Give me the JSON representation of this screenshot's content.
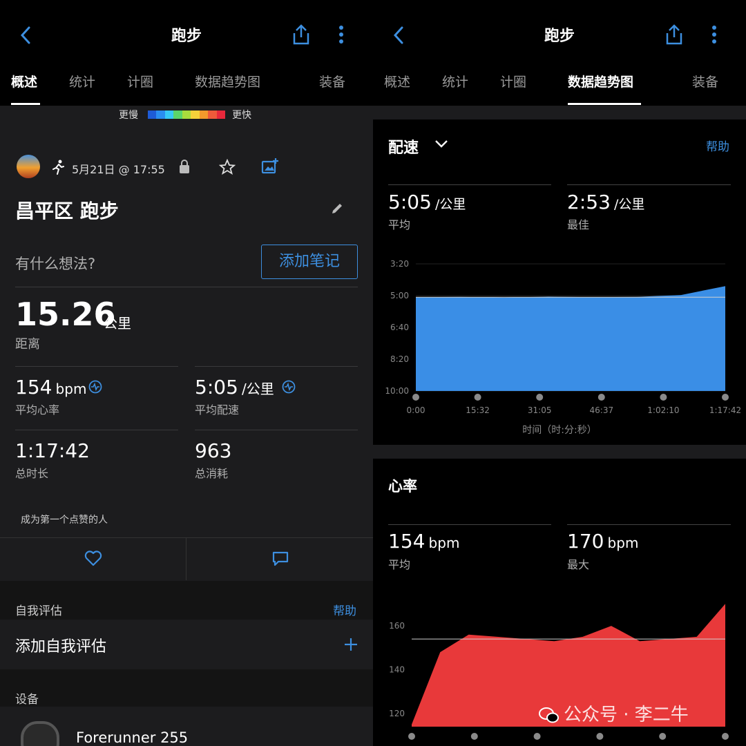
{
  "left": {
    "nav": {
      "title": "跑步"
    },
    "tabs": [
      "概述",
      "统计",
      "计圈",
      "数据趋势图",
      "装备"
    ],
    "pace_legend": {
      "slow": "更慢",
      "fast": "更快",
      "colors": [
        "#1e5bd6",
        "#2a8df0",
        "#36c8f5",
        "#5bd46a",
        "#a9db3d",
        "#f5d23a",
        "#f39a2c",
        "#ef5a3a",
        "#e8283b"
      ]
    },
    "activity": {
      "date": "5月21日 @ 17:55",
      "title": "昌平区 跑步"
    },
    "note": {
      "prompt": "有什么想法?",
      "button": "添加笔记"
    },
    "distance": {
      "value": "15.26",
      "unit": "公里",
      "label": "距离"
    },
    "stats": [
      {
        "value": "154",
        "unit": "bpm",
        "label": "平均心率"
      },
      {
        "value": "5:05",
        "unit": "/公里",
        "label": "平均配速"
      },
      {
        "value": "1:17:42",
        "unit": "",
        "label": "总时长"
      },
      {
        "value": "963",
        "unit": "",
        "label": "总消耗"
      }
    ],
    "likes": "成为第一个点赞的人",
    "self_eval": {
      "header": "自我评估",
      "help": "帮助",
      "add": "添加自我评估"
    },
    "device": {
      "header": "设备",
      "name": "Forerunner 255"
    }
  },
  "right": {
    "nav": {
      "title": "跑步"
    },
    "tabs": [
      "概述",
      "统计",
      "计圈",
      "数据趋势图",
      "装备"
    ],
    "pace": {
      "title": "配速",
      "help": "帮助",
      "avg": {
        "value": "5:05",
        "unit": "/公里",
        "label": "平均"
      },
      "best": {
        "value": "2:53",
        "unit": "/公里",
        "label": "最佳"
      },
      "xaxis_title": "时间（时:分:秒）"
    },
    "hr": {
      "title": "心率",
      "avg": {
        "value": "154",
        "unit": "bpm",
        "label": "平均"
      },
      "max": {
        "value": "170",
        "unit": "bpm",
        "label": "最大"
      }
    }
  },
  "watermark": "公众号 · 李二牛",
  "chart_data": [
    {
      "type": "area",
      "xlabel": "时间（时:分:秒）",
      "x_ticks": [
        "0:00",
        "15:32",
        "31:05",
        "46:37",
        "1:02:10",
        "1:17:42"
      ],
      "y_ticks": [
        "3:20",
        "5:00",
        "6:40",
        "8:20",
        "10:00"
      ],
      "ylim": [
        "10:00",
        "3:20"
      ],
      "reference_line": "5:05",
      "series": [
        {
          "values": [
            "5:05",
            "5:04",
            "5:06",
            "5:03",
            "5:05",
            "5:04",
            "4:58",
            "4:30"
          ]
        }
      ],
      "color": "#3a8ee6"
    },
    {
      "type": "area",
      "y_ticks": [
        "160",
        "140",
        "120"
      ],
      "ylim": [
        114,
        172
      ],
      "reference_line": 154,
      "series": [
        {
          "values": [
            115,
            148,
            156,
            155,
            154,
            153,
            155,
            160,
            153,
            154,
            155,
            170
          ]
        }
      ],
      "color": "#e8393a"
    }
  ]
}
